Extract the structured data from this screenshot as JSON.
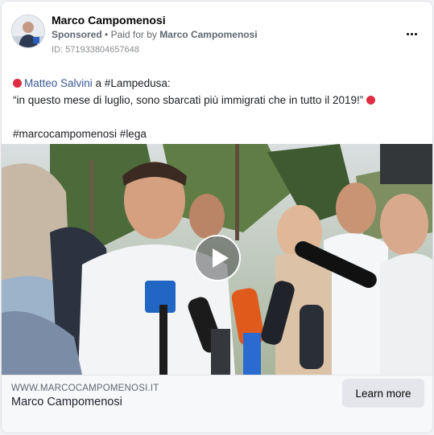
{
  "post": {
    "page_name": "Marco Campomenosi",
    "sponsored_label": "Sponsored",
    "separator": "•",
    "paid_for_prefix": "Paid for by",
    "paid_for_name": "Marco Campomenosi",
    "ad_id": "ID: 571933804657648",
    "more_icon": "more-horizontal-icon"
  },
  "body": {
    "line1_mention": "Matteo Salvini",
    "line1_rest": " a #Lampedusa:",
    "line2": "“in questo mese di luglio, sono sbarcati più immigrati che in tutto il 2019!”",
    "hashtags": "#marcocampomenosi #lega",
    "emoji": "red-circle-icon"
  },
  "media": {
    "type": "video",
    "play_icon": "play-icon"
  },
  "link": {
    "domain": "WWW.MARCOCAMPOMENOSI.IT",
    "title": "Marco Campomenosi",
    "cta_label": "Learn more"
  },
  "colors": {
    "mention": "#385898",
    "red_dot": "#dd2e44",
    "cta_bg": "#e4e6eb"
  }
}
